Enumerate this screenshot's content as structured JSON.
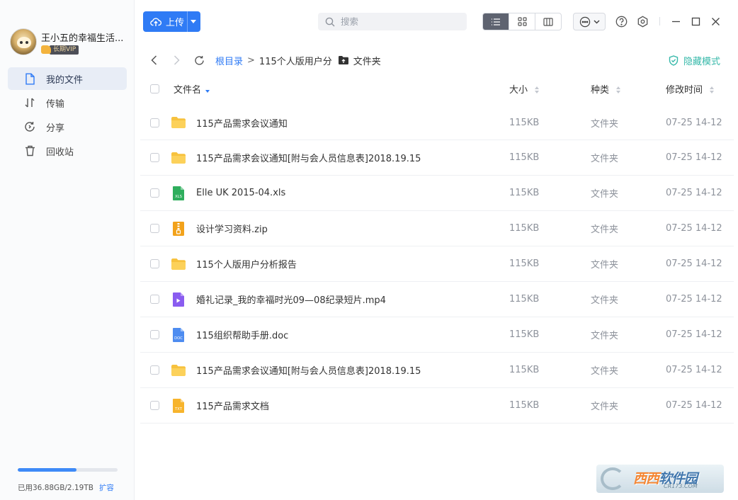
{
  "user": {
    "name": "王小五的幸福生活...",
    "vip_label": "长期VIP"
  },
  "nav": {
    "items": [
      {
        "label": "我的文件",
        "icon": "file-icon",
        "active": true
      },
      {
        "label": "传输",
        "icon": "transfer-icon",
        "active": false
      },
      {
        "label": "分享",
        "icon": "share-icon",
        "active": false
      },
      {
        "label": "回收站",
        "icon": "trash-icon",
        "active": false
      }
    ]
  },
  "storage": {
    "used_text": "已用36.88GB/2.19TB",
    "expand_label": "扩容",
    "percent": 59
  },
  "toolbar": {
    "upload_label": "上传",
    "search_placeholder": "搜索"
  },
  "breadcrumb": {
    "root": "根目录",
    "level1": "115个人版用户分",
    "current": "文件夹"
  },
  "hidden_mode_label": "隐藏模式",
  "table": {
    "headers": {
      "name": "文件名",
      "size": "大小",
      "type": "种类",
      "modified": "修改时间"
    },
    "rows": [
      {
        "name": "115产品需求会议通知",
        "icon": "folder-icon",
        "size": "115KB",
        "type": "文件夹",
        "modified": "07-25 14-12"
      },
      {
        "name": "115产品需求会议通知[附与会人员信息表]2018.19.15",
        "icon": "folder-icon",
        "size": "115KB",
        "type": "文件夹",
        "modified": "07-25 14-12"
      },
      {
        "name": "Elle UK 2015-04.xls",
        "icon": "xls-file-icon",
        "size": "115KB",
        "type": "文件夹",
        "modified": "07-25 14-12"
      },
      {
        "name": "设计学习资料.zip",
        "icon": "zip-file-icon",
        "size": "115KB",
        "type": "文件夹",
        "modified": "07-25 14-12"
      },
      {
        "name": "115个人版用户分析报告",
        "icon": "folder-icon",
        "size": "115KB",
        "type": "文件夹",
        "modified": "07-25 14-12"
      },
      {
        "name": "婚礼记录_我的幸福时光09—08纪录短片.mp4",
        "icon": "video-file-icon",
        "size": "115KB",
        "type": "文件夹",
        "modified": "07-25 14-12"
      },
      {
        "name": "115组织帮助手册.doc",
        "icon": "doc-file-icon",
        "size": "115KB",
        "type": "文件夹",
        "modified": "07-25 14-12"
      },
      {
        "name": "115产品需求会议通知[附与会人员信息表]2018.19.15",
        "icon": "folder-icon",
        "size": "115KB",
        "type": "文件夹",
        "modified": "07-25 14-12"
      },
      {
        "name": "115产品需求文档",
        "icon": "txt-file-icon",
        "size": "115KB",
        "type": "文件夹",
        "modified": "07-25 14-12"
      }
    ]
  },
  "icon_badges": {
    "xls": "XLS",
    "doc": "DOC",
    "txt": "TXT"
  },
  "watermark": {
    "brand_a": "西西",
    "brand_b": "软件园",
    "url": "CR173.COM"
  },
  "colors": {
    "accent": "#2f7bf5",
    "folder": "#f7c23e",
    "xls": "#2fae5d",
    "zip": "#f2a21b",
    "video": "#8a5cf0",
    "doc": "#4e8cf0",
    "txt": "#f7b42c",
    "hidden_mode": "#35b8a9"
  }
}
